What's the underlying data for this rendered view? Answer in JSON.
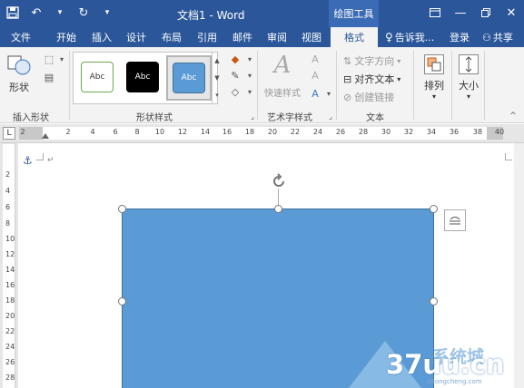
{
  "titlebar": {
    "doc_title": "文档1 - Word",
    "context_tab_group": "绘图工具",
    "qat": {
      "save_icon": "save-icon",
      "undo_icon": "undo-icon",
      "redo_icon": "redo-icon",
      "customize_icon": "customize-qat-icon"
    },
    "win_buttons": [
      "ribbon-display-icon",
      "minimize-icon",
      "restore-icon",
      "close-icon"
    ]
  },
  "tabs": [
    "文件",
    "开始",
    "插入",
    "设计",
    "布局",
    "引用",
    "邮件",
    "审阅",
    "视图",
    "格式"
  ],
  "active_tab": "格式",
  "tell_me": "告诉我...",
  "sign_in": "登录",
  "share": "共享",
  "ribbon": {
    "insert_shapes": {
      "shape_label": "形状",
      "group_label": "插入形状"
    },
    "shape_styles": {
      "group_label": "形状样式",
      "styles": [
        "Abc",
        "Abc",
        "Abc"
      ]
    },
    "wordart": {
      "quick_styles": "快速样式",
      "group_label": "艺术字样式",
      "letter": "A"
    },
    "text": {
      "direction": "文字方向",
      "align": "对齐文本",
      "create_link": "创建链接",
      "group_label": "文本"
    },
    "arrange": {
      "label": "排列"
    },
    "size": {
      "label": "大小"
    }
  },
  "ruler": {
    "corner": "L",
    "numbers": [
      "2",
      "2",
      "4",
      "6",
      "8",
      "10",
      "12",
      "14",
      "16",
      "18",
      "20",
      "22",
      "24",
      "26",
      "28",
      "30",
      "32",
      "34",
      "36",
      "38",
      "40"
    ],
    "vertical_numbers": [
      "2",
      "4",
      "6",
      "8",
      "10",
      "12",
      "14",
      "16",
      "18",
      "20",
      "22",
      "24",
      "26",
      "28",
      "30"
    ]
  },
  "document": {
    "anchor_icon": "anchor-icon",
    "paragraph_mark": "↵"
  },
  "shape": {
    "fill_color": "#5b9bd5",
    "border_color": "#41719c"
  },
  "colors": {
    "brand": "#2b579a",
    "ribbon_bg": "#f3f3f3"
  },
  "watermark": {
    "text": "37uu.cn",
    "cn": "系统城",
    "site": "xitongcheng.com"
  }
}
